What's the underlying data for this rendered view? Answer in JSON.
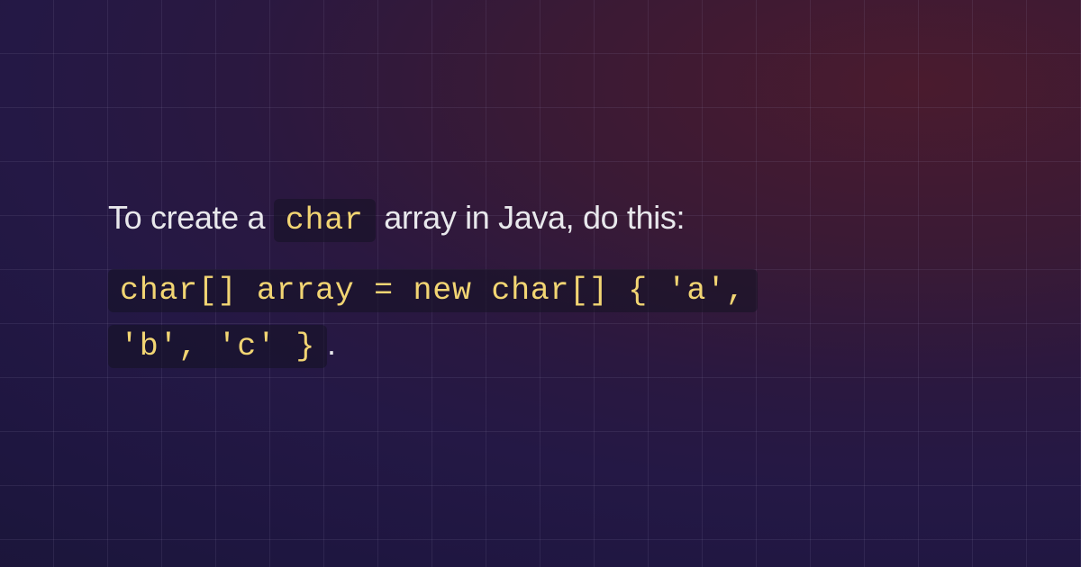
{
  "colors": {
    "text": "#e8e8ec",
    "code_text": "#f2d573",
    "code_bg": "rgba(20, 18, 35, 0.55)"
  },
  "text": {
    "line1_part1": "To create a ",
    "line1_code": "char",
    "line1_part2": " array in Java, do this: ",
    "line2_code1": "char[] array = new char[] { 'a',",
    "line2_code2": "'b', 'c' }",
    "line2_period": "."
  }
}
